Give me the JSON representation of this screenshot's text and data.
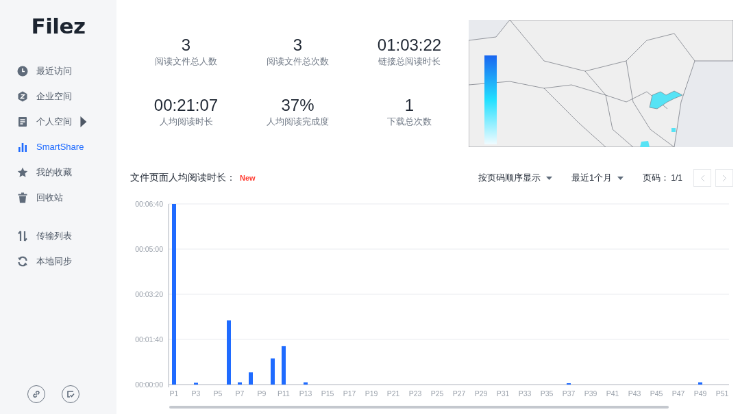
{
  "sidebar": {
    "logo": "Filez",
    "nav": [
      {
        "label": "最近访问",
        "selected": false
      },
      {
        "label": "企业空间",
        "selected": false
      },
      {
        "label": "个人空间",
        "selected": false,
        "expanded": false
      },
      {
        "label": "SmartShare",
        "selected": true
      },
      {
        "label": "我的收藏",
        "selected": false
      },
      {
        "label": "回收站",
        "selected": false
      }
    ],
    "nav_secondary": [
      {
        "label": "传输列表",
        "selected": false
      },
      {
        "label": "本地同步",
        "selected": false
      }
    ]
  },
  "stats": [
    {
      "value": "3",
      "label": "阅读文件总人数"
    },
    {
      "value": "3",
      "label": "阅读文件总次数"
    },
    {
      "value": "01:03:22",
      "label": "链接总阅读时长"
    },
    {
      "value": "00:21:07",
      "label": "人均阅读时长"
    },
    {
      "value": "37%",
      "label": "人均阅读完成度"
    },
    {
      "value": "1",
      "label": "下载总次数"
    }
  ],
  "page_chart": {
    "title": "文件页面人均阅读时长：",
    "badge": "New",
    "sort_dropdown": {
      "label": "按页码顺序显示"
    },
    "period_dropdown": {
      "label": "最近1个月"
    },
    "pagination": {
      "label": "页码：",
      "value": "1/1",
      "prev_disabled": true,
      "next_disabled": true
    },
    "chart_data": {
      "type": "bar",
      "categories": [
        "P1",
        null,
        "P3",
        null,
        "P5",
        null,
        "P7",
        null,
        "P9",
        null,
        "P11",
        null,
        "P13",
        null,
        "P15",
        null,
        "P17",
        null,
        "P19",
        null,
        "P21",
        null,
        "P23",
        null,
        "P25",
        null,
        "P27",
        null,
        "P29",
        null,
        "P31",
        null,
        "P33",
        null,
        "P35",
        null,
        "P37",
        null,
        "P39",
        null,
        "P41",
        null,
        "P43",
        null,
        "P45",
        null,
        "P47",
        null,
        "P49",
        null,
        "P51"
      ],
      "grid": true,
      "series": [
        {
          "color": "#1f6bff",
          "values": [
            400,
            0,
            4,
            0,
            0,
            142,
            5,
            27,
            0,
            58,
            85,
            0,
            5,
            0,
            0,
            0,
            0,
            0,
            0,
            0,
            0,
            0,
            0,
            0,
            0,
            0,
            0,
            0,
            0,
            0,
            0,
            0,
            0,
            0,
            0,
            0,
            3,
            0,
            0,
            0,
            0,
            0,
            0,
            0,
            0,
            0,
            0,
            0,
            5,
            0,
            0
          ]
        }
      ],
      "ylim": [
        0,
        400
      ],
      "yticks": [
        {
          "value": 0,
          "label": "00:00:00"
        },
        {
          "value": 100,
          "label": "00:01:40"
        },
        {
          "value": 200,
          "label": "00:03:20"
        },
        {
          "value": 300,
          "label": "00:05:00"
        },
        {
          "value": 400,
          "label": "00:06:40"
        }
      ]
    }
  }
}
